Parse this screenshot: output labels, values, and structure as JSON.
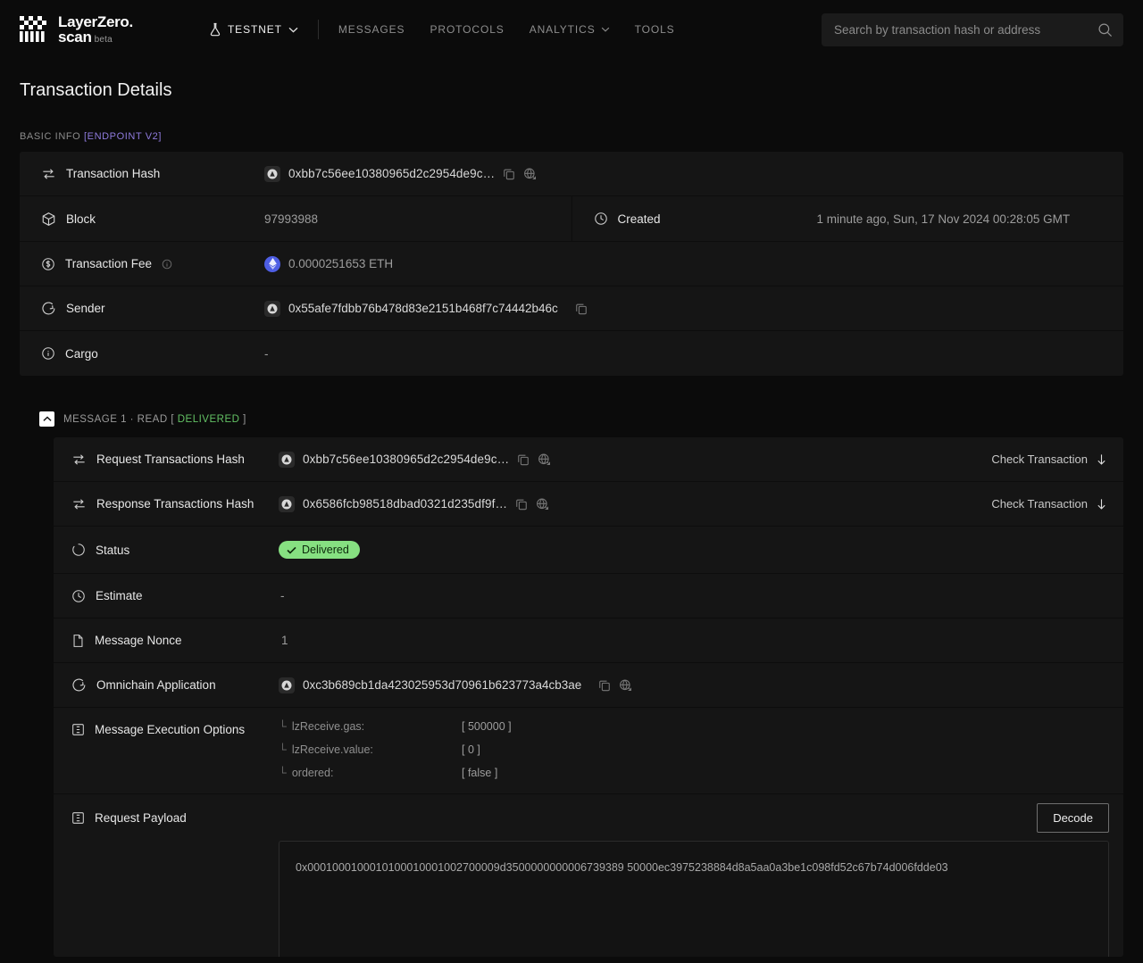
{
  "header": {
    "brand_line1": "LayerZero.",
    "brand_line2": "scan",
    "brand_beta": "beta",
    "network": "TESTNET",
    "nav": [
      {
        "label": "MESSAGES",
        "has_caret": false
      },
      {
        "label": "PROTOCOLS",
        "has_caret": false
      },
      {
        "label": "ANALYTICS",
        "has_caret": true
      },
      {
        "label": "TOOLS",
        "has_caret": false
      }
    ],
    "search_placeholder": "Search by transaction hash or address",
    "search_value": ""
  },
  "page": {
    "title": "Transaction Details",
    "section_label": "BASIC INFO",
    "section_tag": "[ENDPOINT V2]"
  },
  "basic_info": {
    "transaction_hash_label": "Transaction Hash",
    "transaction_hash_value": "0xbb7c56ee10380965d2c2954de9c…",
    "block_label": "Block",
    "block_value": "97993988",
    "created_label": "Created",
    "created_value": "1 minute ago, Sun, 17 Nov 2024 00:28:05 GMT",
    "transaction_fee_label": "Transaction Fee",
    "transaction_fee_value": "0.0000251653 ETH",
    "sender_label": "Sender",
    "sender_value": "0x55afe7fdbb76b478d83e2151b468f7c74442b46c",
    "cargo_label": "Cargo",
    "cargo_value": "-"
  },
  "message": {
    "head_prefix": "MESSAGE 1 · READ [ ",
    "head_status": "DELIVERED",
    "head_suffix": " ]",
    "request_hash_label": "Request Transactions Hash",
    "request_hash_value": "0xbb7c56ee10380965d2c2954de9c…",
    "request_action": "Check Transaction",
    "response_hash_label": "Response Transactions Hash",
    "response_hash_value": "0x6586fcb98518dbad0321d235df9f…",
    "response_action": "Check Transaction",
    "status_label": "Status",
    "status_badge": "Delivered",
    "estimate_label": "Estimate",
    "estimate_value": "-",
    "nonce_label": "Message Nonce",
    "nonce_value": "1",
    "oapp_label": "Omnichain Application",
    "oapp_value": "0xc3b689cb1da423025953d70961b623773a4cb3ae",
    "exec_options_label": "Message Execution Options",
    "exec_options": [
      {
        "key": "lzReceive.gas:",
        "value": "[ 500000 ]"
      },
      {
        "key": "lzReceive.value:",
        "value": "[ 0 ]"
      },
      {
        "key": "ordered:",
        "value": "[ false ]"
      }
    ],
    "payload_label": "Request Payload",
    "decode_label": "Decode",
    "payload_value": "0x0001000100010100010001002700009d3500000000006739389 50000ec3975238884d8a5aa0a3be1c098fd52c67b74d006fdde03"
  },
  "colors": {
    "accent_purple": "#8f7bdd",
    "status_green": "#86e081",
    "eth_blue": "#4e5ee4",
    "panel": "#151515",
    "background": "#0b0b0b"
  }
}
